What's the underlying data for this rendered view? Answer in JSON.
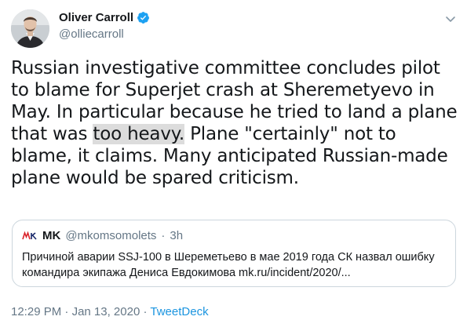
{
  "author": {
    "name": "Oliver Carroll",
    "handle": "@olliecarroll",
    "verified": true
  },
  "tweet": {
    "text_part1": "Russian investigative committee concludes pilot to blame for Superjet crash at Sheremetyevo in May. In particular because he tried to land a plane that was ",
    "highlight": "too heavy.",
    "text_part2": " Plane \"certainly\" not to blame, it claims. Many anticipated Russian-made plane would be spared criticism."
  },
  "quote": {
    "name": "MK",
    "handle": "@mkomsomolets",
    "separator": "·",
    "time": "3h",
    "line1": "Причиной аварии SSJ-100 в Шереметьево в мае 2019 года СК назвал ошибку",
    "line2": "командира экипажа Дениса Евдокимова mk.ru/incident/2020/..."
  },
  "meta": {
    "time": "12:29 PM",
    "date": "Jan 13, 2020",
    "separator1": " · ",
    "separator2": " · ",
    "source": "TweetDeck"
  },
  "colors": {
    "verified": "#1da1f2",
    "secondary_text": "#657786",
    "link": "#1b95e0",
    "highlight": "#dcdcdc",
    "mk_logo": "#d9222a"
  },
  "icons": {
    "caret": "chevron-down-icon",
    "verified": "verified-badge-icon"
  }
}
